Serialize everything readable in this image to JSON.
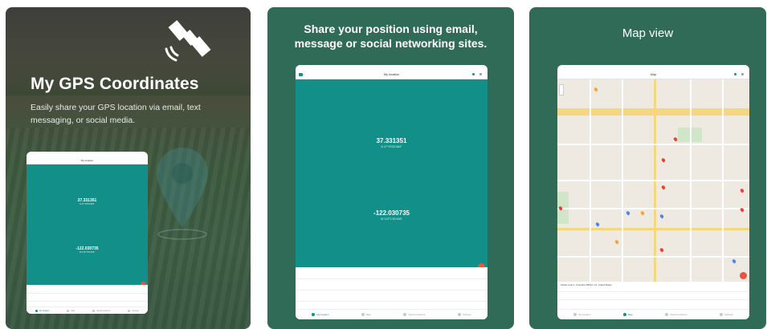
{
  "panel1": {
    "title": "My GPS Coordinates",
    "subtitle": "Easily share your GPS location via email, text messaging, or social media.",
    "tablet": {
      "appbar_title": "My location",
      "latitude": "37.331351",
      "latitude_dms": "N 37°19'52.864\"",
      "longitude": "-122.030735",
      "longitude_dms": "W 122°1'50.646\"",
      "nav": [
        "My location",
        "Map",
        "Saved locations",
        "Settings"
      ]
    }
  },
  "panel2": {
    "title": "Share your position using email, message or social networking sites.",
    "tablet": {
      "appbar_title": "My location",
      "latitude": "37.331351",
      "latitude_dms": "N 37°19'52.864\"",
      "longitude": "-122.030735",
      "longitude_dms": "W 122°1'50.646\"",
      "nav": [
        "My location",
        "Map",
        "Saved locations",
        "Settings"
      ]
    }
  },
  "panel3": {
    "title": "Map view",
    "tablet": {
      "appbar_title": "Map",
      "address": "Infinite Loop 1, Cupertino 95014, CA, United States",
      "nav": [
        "My location",
        "Map",
        "Saved locations",
        "Settings"
      ]
    }
  },
  "colors": {
    "panel_bg": "#2f6b56",
    "teal": "#138f8a",
    "fab": "#e8553e"
  }
}
